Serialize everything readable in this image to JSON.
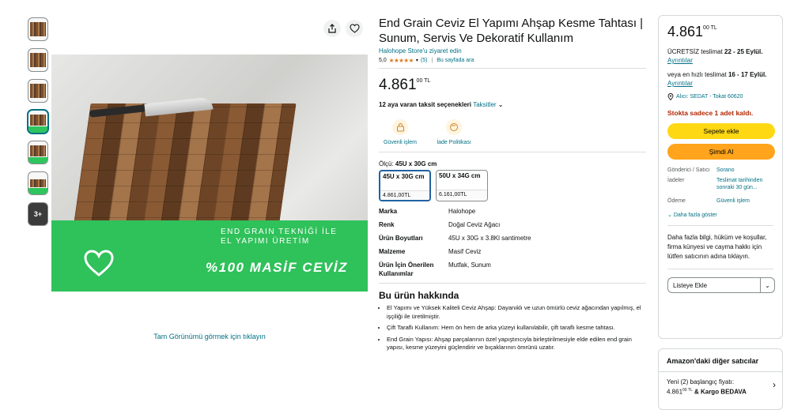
{
  "thumbnails": {
    "more_label": "3+"
  },
  "image": {
    "promo_line1": "END GRAIN TEKNİĞİ İLE",
    "promo_line2": "EL YAPIMI ÜRETİM",
    "promo_big": "%100 MASİF CEVİZ",
    "full_view_link": "Tam Görünümü görmek için tıklayın"
  },
  "product": {
    "title": "End Grain Ceviz El Yapımı Ahşap Kesme Tahtası | Sunum, Servis Ve Dekoratif Kullanım",
    "store_link": "Halohope Store'u ziyaret edin",
    "rating": "5,0",
    "stars": "★★★★★",
    "review_count": "(5)",
    "search_page": "Bu sayfada ara",
    "price_whole": "4.861",
    "price_frac": "00 TL",
    "installments_text": "12 aya varan taksit seçenekleri",
    "installments_link": "Taksitler",
    "badges": [
      {
        "label": "Güvenli işlem",
        "icon": "lock-icon"
      },
      {
        "label": "İade Politikası",
        "icon": "return-icon"
      }
    ],
    "size_label": "Ölçü:",
    "size_value": "45U x 30G cm",
    "sizes": [
      {
        "name": "45U x 30G cm",
        "price": "4.861,00TL"
      },
      {
        "name": "50U x 34G cm",
        "price": "6.161,00TL"
      }
    ],
    "specs": [
      {
        "k": "Marka",
        "v": "Halohope"
      },
      {
        "k": "Renk",
        "v": "Doğal Ceviz Ağacı"
      },
      {
        "k": "Ürün Boyutları",
        "v": "45U x 30G x 3.8Kl santimetre"
      },
      {
        "k": "Malzeme",
        "v": "Masif Ceviz"
      },
      {
        "k": "Ürün İçin Önerilen Kullanımlar",
        "v": "Mutfak, Sunum"
      }
    ],
    "about_title": "Bu ürün hakkında",
    "bullets": [
      "El Yapımı ve Yüksek Kaliteli Ceviz Ahşap: Dayanıklı ve uzun ömürlü ceviz ağacından yapılmış, el işçiliği ile üretilmiştir.",
      "Çift Taraflı Kullanım: Hem ön hem de arka yüzeyi kullanılabilir, çift taraflı kesme tahtası.",
      "End Grain Yapısı: Ahşap parçalarının özel yapıştırıcıyla birleştirilmesiyle elde edilen end grain yapısı, kesme yüzeyini güçlendirir ve bıçaklarının ömrünü uzatır."
    ]
  },
  "buybox": {
    "price_whole": "4.861",
    "price_frac": "00 TL",
    "free_delivery": "ÜCRETSİZ teslimat",
    "free_dates": "22 - 25 Eylül.",
    "details": "Ayrıntılar",
    "fast_delivery": "veya en hızlı teslimat",
    "fast_dates": "16 - 17 Eylül.",
    "location": "Alıcı: SEDAT - Tokat 60620",
    "stock": "Stokta sadece 1 adet kaldı.",
    "add_to_cart": "Sepete ekle",
    "buy_now": "Şimdi Al",
    "info": [
      {
        "k": "Gönderici / Satıcı",
        "v": "Sorano"
      },
      {
        "k": "İadeler",
        "v": "Teslimat tarihinden sonraki 30 gün..."
      },
      {
        "k": "Ödeme",
        "v": "Güvenli işlem"
      }
    ],
    "show_more": "Daha fazla göster",
    "description": "Daha fazla bilgi, hüküm ve koşullar, firma künyesi ve cayma hakkı için lütfen satıcının adına tıklayın.",
    "wishlist": "Listeye Ekle"
  },
  "other_sellers": {
    "title": "Amazon'daki diğer satıcılar",
    "new_from": "Yeni (2) başlangıç fiyatı:",
    "price_whole": "4.861",
    "price_frac": "00 TL",
    "shipping": "& Kargo BEDAVA"
  },
  "colors": {
    "accent": "#007185",
    "cart": "#ffd814",
    "buy": "#ffa41c",
    "stock": "#b12704",
    "promo": "#2fc15a",
    "stars": "#de7921"
  }
}
